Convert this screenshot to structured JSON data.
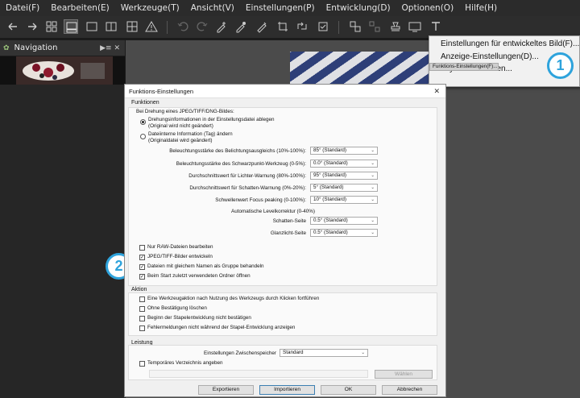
{
  "menubar": [
    "Datei(F)",
    "Bearbeiten(E)",
    "Werkzeuge(T)",
    "Ansicht(V)",
    "Einstellungen(P)",
    "Entwicklung(D)",
    "Optionen(O)",
    "Hilfe(H)"
  ],
  "nav_panel": {
    "title": "Navigation"
  },
  "dropdown": {
    "items": [
      "Einstellungen für entwickeltes Bild(F)...",
      "Anzeige-Einstellungen(D)...",
      "Funktions-Einstellungen(F)...",
      "Layout auswählen..."
    ],
    "selected_index": 2
  },
  "badges": {
    "one": "1",
    "two": "2"
  },
  "dialog": {
    "title": "Funktions-Einstellungen",
    "funktionen": {
      "label": "Funktionen",
      "rotation_caption": "Bei Drehung eines JPEG/TIFF/DNG-Bildes:",
      "radio1_line1": "Drehungsinformationen in der Einstellungsdatei ablegen",
      "radio1_line2": "(Original wird nicht geändert)",
      "radio2_line1": "Dateiinterne Information (Tag) ändern",
      "radio2_line2": "(Originaldatei wird geändert)",
      "rows": [
        {
          "label": "Beleuchtungsstärke des Belichtungsausgleichs (10%-100%):",
          "value": "85° (Standard)"
        },
        {
          "label": "Beleuchtungsstärke des Schwarzpunkt-Werkzeug (0-5%):",
          "value": "0.0° (Standard)"
        },
        {
          "label": "Durchschnittswert für Lichter-Warnung (80%-100%):",
          "value": "95° (Standard)"
        },
        {
          "label": "Durchschnittswert für Schatten-Warnung (0%-20%):",
          "value": "5° (Standard)"
        },
        {
          "label": "Schwellenwert Focus peaking (0-100%):",
          "value": "10° (Standard)"
        }
      ],
      "auto_level_caption": "Automatische Levelkorrektur (0-40%)",
      "level_rows": [
        {
          "label": "Schatten-Seite",
          "value": "0.5° (Standard)"
        },
        {
          "label": "Glanzlicht-Seite",
          "value": "0.5° (Standard)"
        }
      ],
      "checks": [
        {
          "label": "Nur RAW-Dateien bearbeiten",
          "checked": false
        },
        {
          "label": "JPEG/TIFF-Bilder entwickeln",
          "checked": true
        },
        {
          "label": "Dateien mit gleichem Namen als Gruppe behandeln",
          "checked": true
        },
        {
          "label": "Beim Start zuletzt verwendeten Ordner öffnen",
          "checked": true
        }
      ]
    },
    "aktion": {
      "label": "Aktion",
      "checks": [
        {
          "label": "Eine Werkzeugaktion nach Nutzung des Werkzeugs durch Klicken fortführen",
          "checked": false
        },
        {
          "label": "Ohne Bestätigung löschen",
          "checked": false
        },
        {
          "label": "Beginn der Stapelentwicklung nicht bestätigen",
          "checked": false
        },
        {
          "label": "Fehlermeldungen nicht während der Stapel-Entwicklung anzeigen",
          "checked": false
        }
      ]
    },
    "leistung": {
      "label": "Leistung",
      "cache_label": "Einstellungen Zwischenspeicher",
      "cache_value": "Standard",
      "temp_label": "Temporäres Verzeichnis angeben",
      "choose_button": "Wählen"
    },
    "buttons": {
      "export": "Exportieren",
      "import": "Importieren",
      "ok": "OK",
      "cancel": "Abbrechen"
    }
  }
}
